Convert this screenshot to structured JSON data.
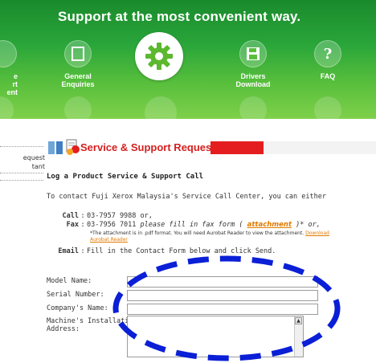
{
  "banner": {
    "title": "Support at the most convenient way.",
    "nav": [
      {
        "label": "e\nrt\nent"
      },
      {
        "label": "General\nEnquiries"
      },
      {
        "label": ""
      },
      {
        "label": "Drivers\nDownload"
      },
      {
        "label": "FAQ"
      }
    ]
  },
  "sidebar": {
    "items": [
      {
        "label": "equest"
      },
      {
        "label": "tant"
      }
    ]
  },
  "section": {
    "title": "Service & Support Request"
  },
  "content": {
    "heading": "Log a Product Service & Support Call",
    "intro": "To contact Fuji Xerox Malaysia's Service Call Center, you can either",
    "call": {
      "key": "Call",
      "value": "03-7957 9988 or,"
    },
    "fax": {
      "key": "Fax",
      "number": "03-7956 7011",
      "italic_text": " please fill in fax form ( ",
      "link": "attachment",
      "after": " )* or,"
    },
    "note": {
      "text": "*The attachment is in .pdf format. You will need Aurobat Reader to view the attachment.",
      "link": "Download Aurobat Reader"
    },
    "email": {
      "key": "Email",
      "value": "Fill in the Contact Form below and click Send."
    }
  },
  "form": {
    "fields": [
      {
        "label": "Model Name:",
        "value": ""
      },
      {
        "label": "Serial Number:",
        "value": ""
      },
      {
        "label": "Company's Name:",
        "value": ""
      },
      {
        "label": "Machine's Installation\nAddress:",
        "value": ""
      }
    ],
    "scroll_arrow": "▲"
  },
  "colors": {
    "banner_green": "#2aa63a",
    "header_red": "#e41e1e",
    "link_orange": "#e07b00",
    "annotation_blue": "#0a1fd6"
  }
}
